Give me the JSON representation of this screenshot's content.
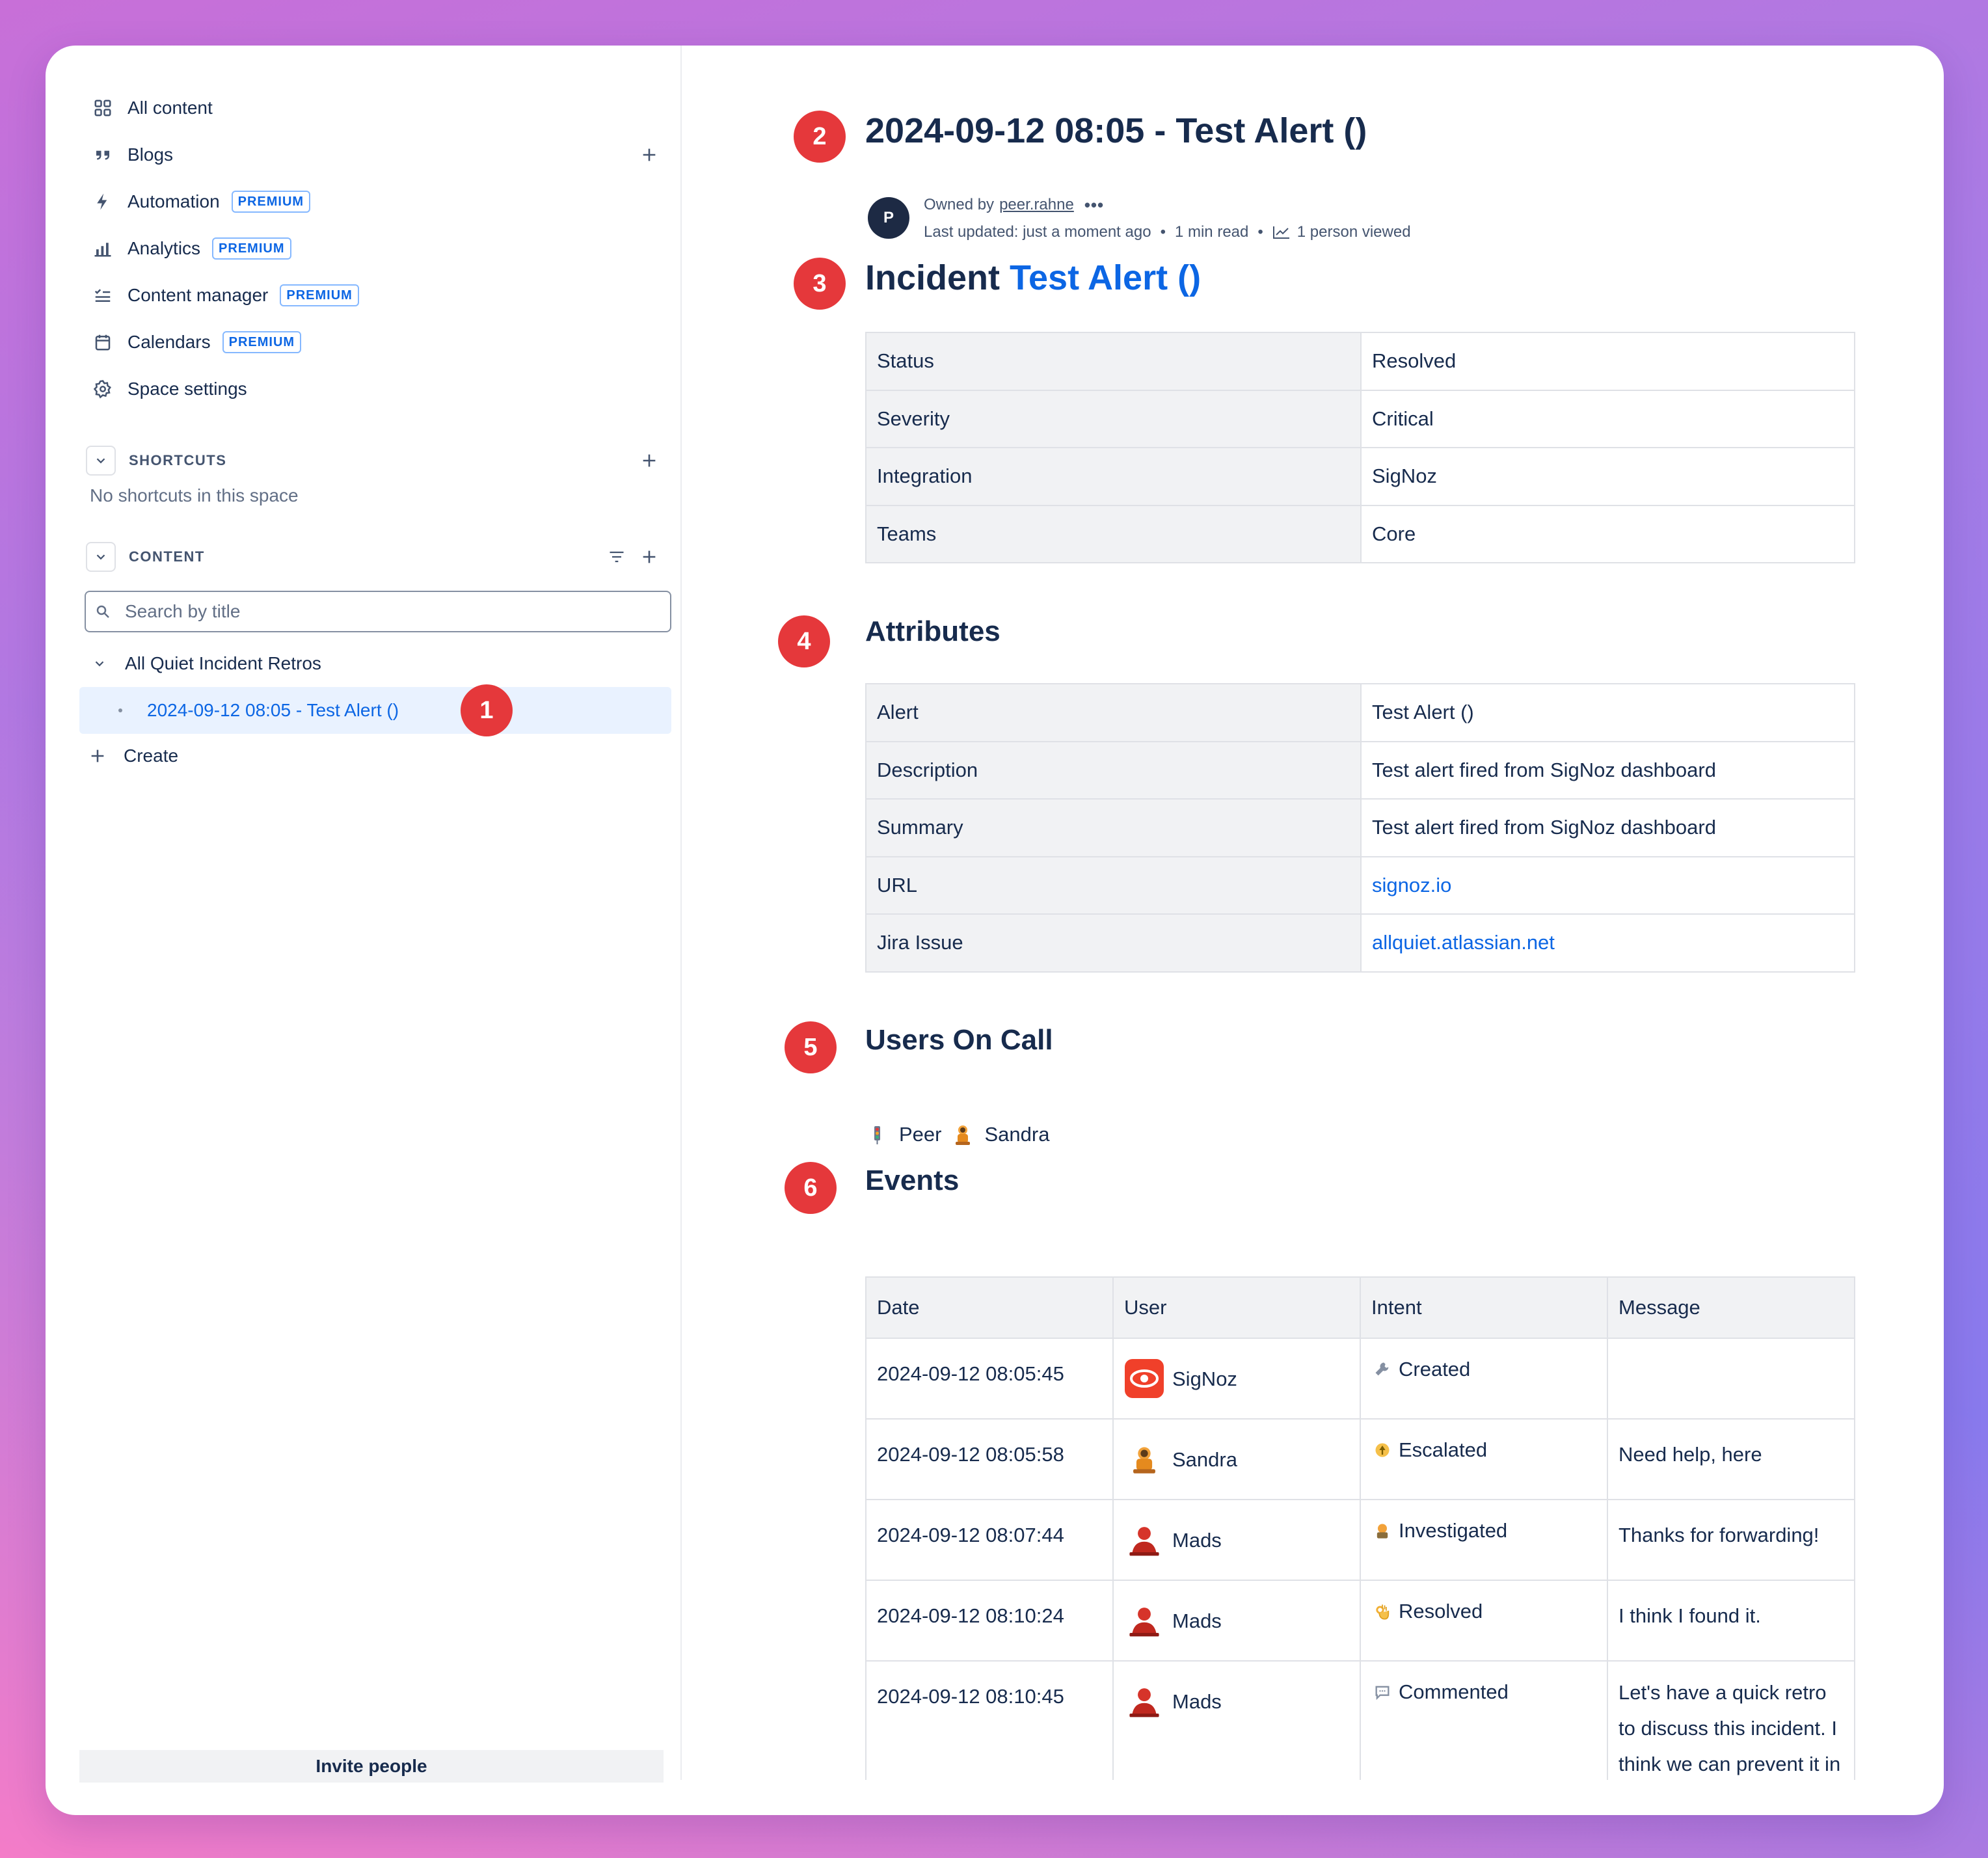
{
  "sidebar": {
    "nav": [
      {
        "label": "All content",
        "icon": "grid-icon"
      },
      {
        "label": "Blogs",
        "icon": "quote-icon"
      },
      {
        "label": "Automation",
        "icon": "lightning-icon",
        "badge": "PREMIUM"
      },
      {
        "label": "Analytics",
        "icon": "bar-chart-icon",
        "badge": "PREMIUM"
      },
      {
        "label": "Content manager",
        "icon": "checklist-icon",
        "badge": "PREMIUM"
      },
      {
        "label": "Calendars",
        "icon": "calendar-icon",
        "badge": "PREMIUM"
      },
      {
        "label": "Space settings",
        "icon": "gear-icon"
      }
    ],
    "shortcuts": {
      "label": "SHORTCUTS",
      "empty_text": "No shortcuts in this space"
    },
    "content": {
      "label": "CONTENT",
      "search_placeholder": "Search by title",
      "tree_parent": "All Quiet Incident Retros",
      "tree_active": "2024-09-12 08:05 - Test Alert ()",
      "create_label": "Create"
    },
    "invite_label": "Invite people"
  },
  "markers": [
    "1",
    "2",
    "3",
    "4",
    "5",
    "6"
  ],
  "page": {
    "title": "2024-09-12 08:05 - Test Alert ()",
    "owner_prefix": "Owned by",
    "owner": "peer.rahne",
    "owner_initial": "P",
    "last_updated": "Last updated: just a moment ago",
    "read_time": "1 min read",
    "viewed": "1 person viewed",
    "heading_prefix": "Incident",
    "heading_link": "Test Alert ()"
  },
  "summary_table": [
    {
      "key": "Status",
      "value": "Resolved"
    },
    {
      "key": "Severity",
      "value": "Critical"
    },
    {
      "key": "Integration",
      "value": "SigNoz"
    },
    {
      "key": "Teams",
      "value": "Core"
    }
  ],
  "attributes": {
    "heading": "Attributes",
    "rows": [
      {
        "key": "Alert",
        "value": "Test Alert ()"
      },
      {
        "key": "Description",
        "value": "Test alert fired from SigNoz dashboard"
      },
      {
        "key": "Summary",
        "value": "Test alert fired from SigNoz dashboard"
      },
      {
        "key": "URL",
        "value": "signoz.io"
      },
      {
        "key": "Jira Issue",
        "value": "allquiet.atlassian.net"
      }
    ]
  },
  "on_call": {
    "heading": "Users On Call",
    "users": [
      "Peer",
      "Sandra"
    ]
  },
  "events": {
    "heading": "Events",
    "columns": [
      "Date",
      "User",
      "Intent",
      "Message"
    ],
    "rows": [
      {
        "date": "2024-09-12 08:05:45",
        "user": "SigNoz",
        "intent": "Created",
        "message": ""
      },
      {
        "date": "2024-09-12 08:05:58",
        "user": "Sandra",
        "intent": "Escalated",
        "message": "Need help, here"
      },
      {
        "date": "2024-09-12 08:07:44",
        "user": "Mads",
        "intent": "Investigated",
        "message": "Thanks for forwarding!"
      },
      {
        "date": "2024-09-12 08:10:24",
        "user": "Mads",
        "intent": "Resolved",
        "message": "I think I found it."
      },
      {
        "date": "2024-09-12 08:10:45",
        "user": "Mads",
        "intent": "Commented",
        "message": " Let's have a quick retro to discuss this incident. I think we can prevent it in the future."
      }
    ]
  },
  "colors": {
    "accent": "#0c66e4",
    "marker": "#e5383b",
    "active_bg": "#e9f2ff"
  }
}
